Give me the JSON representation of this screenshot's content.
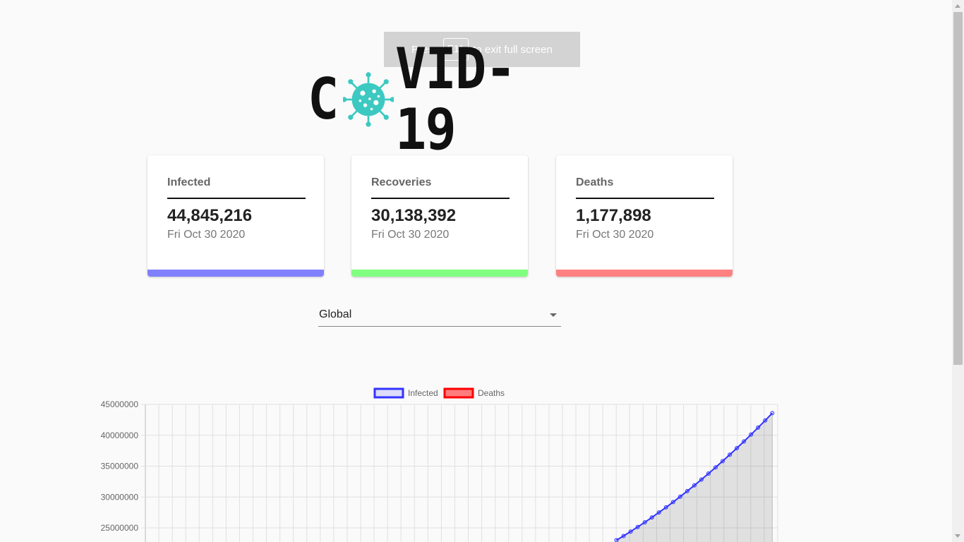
{
  "fullscreen_notice": {
    "press": "Press",
    "key": "F11",
    "rest": "to exit full screen"
  },
  "logo": {
    "left": "C",
    "right": "VID-19",
    "icon": "virus-icon",
    "icon_color": "#3cc9c1"
  },
  "cards": [
    {
      "label": "Infected",
      "value": "44,845,216",
      "date": "Fri Oct 30 2020",
      "color": "#8080ff"
    },
    {
      "label": "Recoveries",
      "value": "30,138,392",
      "date": "Fri Oct 30 2020",
      "color": "#80ff80"
    },
    {
      "label": "Deaths",
      "value": "1,177,898",
      "date": "Fri Oct 30 2020",
      "color": "#ff8080"
    }
  ],
  "country_select": {
    "value": "Global",
    "icon": "chevron-down-icon"
  },
  "chart_data": {
    "type": "line",
    "legend": [
      {
        "name": "Infected",
        "color": "#3333ff"
      },
      {
        "name": "Deaths",
        "color": "#ff0000"
      }
    ],
    "y_ticks": [
      "45000000",
      "40000000",
      "35000000",
      "30000000",
      "25000000"
    ],
    "ylim": [
      25000000,
      45000000
    ],
    "series": [
      {
        "name": "Infected",
        "end_segment": [
          [
            0.75,
            23000000
          ],
          [
            0.8,
            25800000
          ],
          [
            0.85,
            28800000
          ],
          [
            0.9,
            32000000
          ],
          [
            0.95,
            36000000
          ],
          [
            1.0,
            44500000
          ]
        ]
      }
    ],
    "grid": true,
    "area_fill": true
  }
}
